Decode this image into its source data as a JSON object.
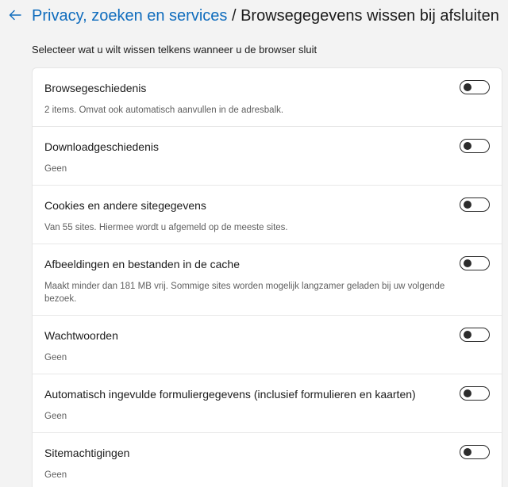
{
  "header": {
    "breadcrumb_link": "Privacy, zoeken en services",
    "separator": " / ",
    "current_page": "Browsegegevens wissen bij afsluiten"
  },
  "subtitle": "Selecteer wat u wilt wissen telkens wanneer u de browser sluit",
  "items": [
    {
      "label": "Browsegeschiedenis",
      "desc": "2 items. Omvat ook automatisch aanvullen in de adresbalk.",
      "enabled": false
    },
    {
      "label": "Downloadgeschiedenis",
      "desc": "Geen",
      "enabled": false
    },
    {
      "label": "Cookies en andere sitegegevens",
      "desc": "Van 55 sites. Hiermee wordt u afgemeld op de meeste sites.",
      "enabled": false
    },
    {
      "label": "Afbeeldingen en bestanden in de cache",
      "desc": "Maakt minder dan 181 MB vrij. Sommige sites worden mogelijk langzamer geladen bij uw volgende bezoek.",
      "enabled": false
    },
    {
      "label": "Wachtwoorden",
      "desc": "Geen",
      "enabled": false
    },
    {
      "label": "Automatisch ingevulde formuliergegevens (inclusief formulieren en kaarten)",
      "desc": "Geen",
      "enabled": false
    },
    {
      "label": "Sitemachtigingen",
      "desc": "Geen",
      "enabled": false
    }
  ],
  "colors": {
    "accent": "#0f6cbd",
    "background": "#f3f3f3"
  },
  "icons": {
    "back": "back-arrow-icon"
  }
}
